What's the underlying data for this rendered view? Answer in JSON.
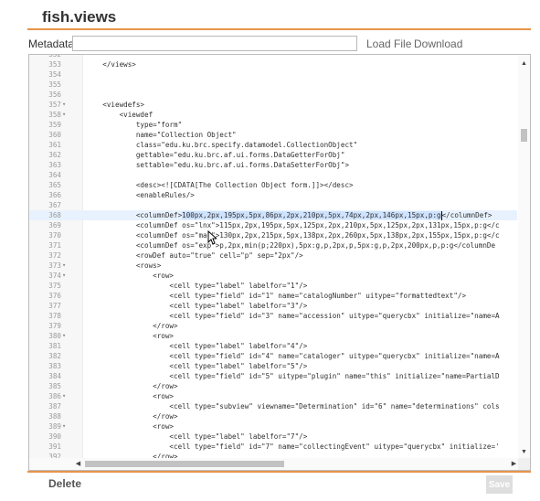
{
  "title": "fish.views",
  "metadata": {
    "label": "Metadata:",
    "value": ""
  },
  "links": {
    "load_file": "Load File",
    "download": "Download"
  },
  "editor": {
    "lines": [
      {
        "n": "352",
        "fold": "",
        "text": ""
      },
      {
        "n": "353",
        "fold": "",
        "text": "    </views>"
      },
      {
        "n": "354",
        "fold": "",
        "text": ""
      },
      {
        "n": "355",
        "fold": "",
        "text": ""
      },
      {
        "n": "356",
        "fold": "",
        "text": ""
      },
      {
        "n": "357",
        "fold": "▾",
        "text": "    <viewdefs>"
      },
      {
        "n": "358",
        "fold": "▾",
        "text": "        <viewdef"
      },
      {
        "n": "359",
        "fold": "",
        "text": "            type=\"form\""
      },
      {
        "n": "360",
        "fold": "",
        "text": "            name=\"Collection Object\""
      },
      {
        "n": "361",
        "fold": "",
        "text": "            class=\"edu.ku.brc.specify.datamodel.CollectionObject\""
      },
      {
        "n": "362",
        "fold": "",
        "text": "            gettable=\"edu.ku.brc.af.ui.forms.DataGetterForObj\""
      },
      {
        "n": "363",
        "fold": "",
        "text": "            settable=\"edu.ku.brc.af.ui.forms.DataSetterForObj\">"
      },
      {
        "n": "364",
        "fold": "",
        "text": ""
      },
      {
        "n": "365",
        "fold": "",
        "text": "            <desc><![CDATA[The Collection Object form.]]></desc>"
      },
      {
        "n": "366",
        "fold": "",
        "text": "            <enableRules/>"
      },
      {
        "n": "367",
        "fold": "",
        "text": ""
      },
      {
        "n": "368",
        "fold": "",
        "text": "            <columnDef>",
        "sel": "100px,2px,195px,5px,86px,2px,210px,5px,74px,2px,146px,15px,p:g",
        "after": "</columnDef>",
        "hl": true
      },
      {
        "n": "369",
        "fold": "",
        "text": "            <columnDef os=\"lnx\">115px,2px,195px,5px,125px,2px,210px,5px,125px,2px,131px,15px,p:g</c"
      },
      {
        "n": "370",
        "fold": "",
        "text": "            <columnDef os=\"mac\">130px,2px,215px,5px,138px,2px,260px,5px,138px,2px,155px,15px,p:g</c"
      },
      {
        "n": "371",
        "fold": "",
        "text": "            <columnDef os=\"exp\">p,2px,min(p;220px),5px:g,p,2px,p,5px:g,p,2px,200px,p,p:g</columnDe"
      },
      {
        "n": "372",
        "fold": "",
        "text": "            <rowDef auto=\"true\" cell=\"p\" sep=\"2px\"/>"
      },
      {
        "n": "373",
        "fold": "▾",
        "text": "            <rows>"
      },
      {
        "n": "374",
        "fold": "▾",
        "text": "                <row>"
      },
      {
        "n": "375",
        "fold": "",
        "text": "                    <cell type=\"label\" labelfor=\"1\"/>"
      },
      {
        "n": "376",
        "fold": "",
        "text": "                    <cell type=\"field\" id=\"1\" name=\"catalogNumber\" uitype=\"formattedtext\"/>"
      },
      {
        "n": "377",
        "fold": "",
        "text": "                    <cell type=\"label\" labelfor=\"3\"/>"
      },
      {
        "n": "378",
        "fold": "",
        "text": "                    <cell type=\"field\" id=\"3\" name=\"accession\" uitype=\"querycbx\" initialize=\"name=A"
      },
      {
        "n": "379",
        "fold": "",
        "text": "                </row>"
      },
      {
        "n": "380",
        "fold": "▾",
        "text": "                <row>"
      },
      {
        "n": "381",
        "fold": "",
        "text": "                    <cell type=\"label\" labelfor=\"4\"/>"
      },
      {
        "n": "382",
        "fold": "",
        "text": "                    <cell type=\"field\" id=\"4\" name=\"cataloger\" uitype=\"querycbx\" initialize=\"name=A"
      },
      {
        "n": "383",
        "fold": "",
        "text": "                    <cell type=\"label\" labelfor=\"5\"/>"
      },
      {
        "n": "384",
        "fold": "",
        "text": "                    <cell type=\"field\" id=\"5\" uitype=\"plugin\" name=\"this\" initialize=\"name=PartialD"
      },
      {
        "n": "385",
        "fold": "",
        "text": "                </row>"
      },
      {
        "n": "386",
        "fold": "▾",
        "text": "                <row>"
      },
      {
        "n": "387",
        "fold": "",
        "text": "                    <cell type=\"subview\" viewname=\"Determination\" id=\"6\" name=\"determinations\" cols"
      },
      {
        "n": "388",
        "fold": "",
        "text": "                </row>"
      },
      {
        "n": "389",
        "fold": "▾",
        "text": "                <row>"
      },
      {
        "n": "390",
        "fold": "",
        "text": "                    <cell type=\"label\" labelfor=\"7\"/>"
      },
      {
        "n": "391",
        "fold": "",
        "text": "                    <cell type=\"field\" id=\"7\" name=\"collectingEvent\" uitype=\"querycbx\" initialize='"
      },
      {
        "n": "392",
        "fold": "",
        "text": "                </row>"
      },
      {
        "n": "393",
        "fold": "▾",
        "text": "                <row>"
      },
      {
        "n": "394",
        "fold": "",
        "text": ""
      }
    ]
  },
  "footer": {
    "delete_label": "Delete",
    "save_label": "Save"
  },
  "icons": {
    "scroll_up": "caret-up-icon",
    "scroll_down": "caret-down-icon",
    "scroll_left": "caret-left-icon",
    "scroll_right": "caret-right-icon",
    "fold": "fold-arrow-icon",
    "mouse": "mouse-cursor-icon"
  },
  "colors": {
    "accent": "#e8944a",
    "selection": "#cfe3ff",
    "active_line": "#e8f2ff"
  }
}
